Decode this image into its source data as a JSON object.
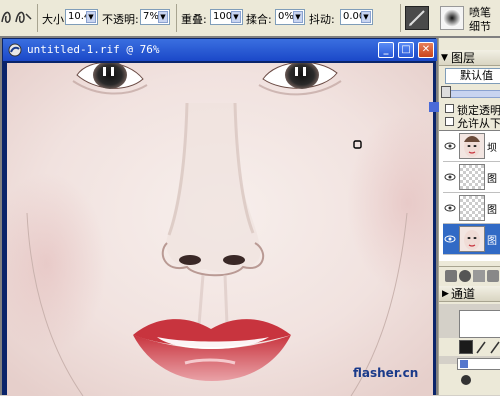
{
  "toolbar": {
    "size_label": "大小",
    "size_value": "10.4",
    "opacity_label": "不透明:",
    "opacity_value": "7%",
    "overlap_label": "重叠:",
    "overlap_value": "100%",
    "jitter_label": "揉合:",
    "jitter_value": "0%",
    "shake_label": "抖动:",
    "shake_value": "0.00",
    "right_label_1": "喷笔",
    "right_label_2": "细节"
  },
  "document": {
    "title": "untitled-1.rif @ 76%",
    "watermark": "flasher.cn"
  },
  "layers_panel": {
    "title": "图层",
    "preset_value": "默认值",
    "lock_transparency": "锁定透明",
    "allow_below": "允许从下面",
    "layers": [
      {
        "name": "坝"
      },
      {
        "name": "图"
      },
      {
        "name": "图"
      },
      {
        "name": "图"
      }
    ],
    "channels_label": "通道"
  },
  "colors": {
    "title_bar": "#1b48c8",
    "selected_layer": "#316ac5",
    "close_button": "#d9582b"
  }
}
